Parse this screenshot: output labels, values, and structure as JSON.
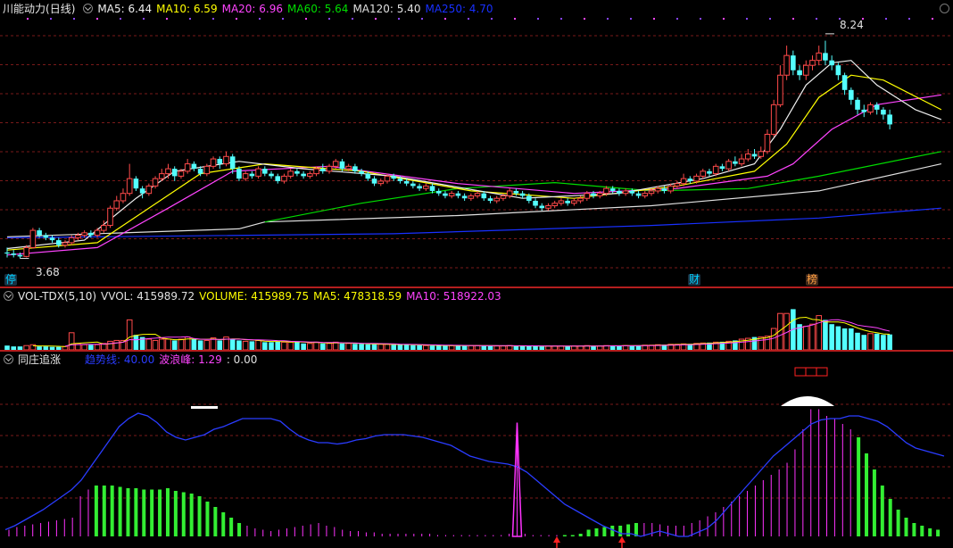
{
  "colors": {
    "up": "#ff4a4a",
    "down": "#54ffff",
    "ma5": "#f0f0f0",
    "ma10": "#ffff00",
    "ma20": "#ff44ff",
    "ma60": "#00dd00",
    "ma120": "#e0e0e0",
    "ma250": "#1830ff",
    "grid": "#7a1a1a",
    "wave": "#2a3cff",
    "green_bar": "#33ee33",
    "magenta_bar": "#ff33ff",
    "arrow": "#ff2222"
  },
  "price_panel": {
    "title": "川能动力",
    "period": "(日线)",
    "ma_legend": [
      {
        "label": "MA5: 6.44",
        "color": "#f0f0f0"
      },
      {
        "label": "MA10: 6.59",
        "color": "#ffff00"
      },
      {
        "label": "MA20: 6.96",
        "color": "#ff44ff"
      },
      {
        "label": "MA60: 5.64",
        "color": "#00dd00"
      },
      {
        "label": "MA120: 5.40",
        "color": "#e0e0e0"
      },
      {
        "label": "MA250: 4.70",
        "color": "#1830ff"
      }
    ],
    "high_label": "8.24",
    "low_label": "3.68",
    "event_tags": [
      "停",
      "财",
      "榜"
    ],
    "icon": "circle-button-icon"
  },
  "volume_panel": {
    "name": "VOL-TDX(5,10)",
    "legend": [
      {
        "label": "VVOL: 415989.72",
        "color": "#e0e0e0"
      },
      {
        "label": "VOLUME: 415989.75",
        "color": "#ffff00"
      },
      {
        "label": "MA5: 478318.59",
        "color": "#ffff00"
      },
      {
        "label": "MA10: 518922.03",
        "color": "#ff44ff"
      }
    ]
  },
  "indicator_panel": {
    "name": "同庄追涨",
    "legend": [
      {
        "label": "趋势线: 40.00",
        "color": "#2a3cff"
      },
      {
        "label": "波浪峰: 1.29",
        "color": "#ff44ff"
      },
      {
        "label": ": 0.00",
        "color": "#e0e0e0"
      }
    ]
  },
  "chart_data": {
    "type": "candlestick",
    "ylim": [
      3.4,
      8.6
    ],
    "high": 8.24,
    "low": 3.68,
    "candles": [
      [
        3.8,
        3.78,
        3.9,
        3.7
      ],
      [
        3.78,
        3.75,
        3.85,
        3.7
      ],
      [
        3.75,
        3.72,
        3.8,
        3.68
      ],
      [
        3.72,
        3.9,
        3.95,
        3.7
      ],
      [
        3.9,
        4.25,
        4.3,
        3.88
      ],
      [
        4.25,
        4.15,
        4.3,
        4.1
      ],
      [
        4.15,
        4.1,
        4.2,
        4.05
      ],
      [
        4.1,
        4.05,
        4.15,
        4.0
      ],
      [
        4.05,
        3.95,
        4.1,
        3.9
      ],
      [
        3.95,
        4.0,
        4.05,
        3.9
      ],
      [
        4.0,
        4.1,
        4.15,
        3.95
      ],
      [
        4.1,
        4.15,
        4.2,
        4.05
      ],
      [
        4.15,
        4.2,
        4.25,
        4.1
      ],
      [
        4.2,
        4.15,
        4.25,
        4.1
      ],
      [
        4.15,
        4.25,
        4.3,
        4.1
      ],
      [
        4.25,
        4.35,
        4.45,
        4.2
      ],
      [
        4.35,
        4.7,
        4.75,
        4.3
      ],
      [
        4.7,
        4.85,
        4.95,
        4.65
      ],
      [
        4.85,
        5.0,
        5.1,
        4.8
      ],
      [
        5.0,
        5.3,
        5.6,
        4.95
      ],
      [
        5.3,
        5.1,
        5.35,
        5.05
      ],
      [
        5.1,
        5.0,
        5.15,
        4.9
      ],
      [
        5.0,
        5.15,
        5.2,
        4.95
      ],
      [
        5.15,
        5.3,
        5.35,
        5.1
      ],
      [
        5.3,
        5.4,
        5.5,
        5.25
      ],
      [
        5.4,
        5.5,
        5.6,
        5.3
      ],
      [
        5.5,
        5.35,
        5.55,
        5.25
      ],
      [
        5.35,
        5.45,
        5.5,
        5.3
      ],
      [
        5.45,
        5.6,
        5.7,
        5.4
      ],
      [
        5.6,
        5.5,
        5.65,
        5.45
      ],
      [
        5.5,
        5.4,
        5.55,
        5.35
      ],
      [
        5.4,
        5.55,
        5.6,
        5.35
      ],
      [
        5.55,
        5.7,
        5.75,
        5.5
      ],
      [
        5.7,
        5.6,
        5.75,
        5.5
      ],
      [
        5.6,
        5.75,
        5.85,
        5.55
      ],
      [
        5.75,
        5.5,
        5.8,
        5.4
      ],
      [
        5.5,
        5.3,
        5.55,
        5.25
      ],
      [
        5.3,
        5.4,
        5.45,
        5.25
      ],
      [
        5.4,
        5.35,
        5.45,
        5.3
      ],
      [
        5.35,
        5.5,
        5.55,
        5.3
      ],
      [
        5.5,
        5.4,
        5.55,
        5.35
      ],
      [
        5.4,
        5.35,
        5.45,
        5.3
      ],
      [
        5.35,
        5.25,
        5.4,
        5.2
      ],
      [
        5.25,
        5.35,
        5.4,
        5.2
      ],
      [
        5.35,
        5.45,
        5.5,
        5.3
      ],
      [
        5.45,
        5.4,
        5.5,
        5.35
      ],
      [
        5.4,
        5.35,
        5.45,
        5.3
      ],
      [
        5.35,
        5.4,
        5.45,
        5.3
      ],
      [
        5.4,
        5.5,
        5.55,
        5.35
      ],
      [
        5.5,
        5.45,
        5.6,
        5.4
      ],
      [
        5.45,
        5.55,
        5.6,
        5.4
      ],
      [
        5.55,
        5.65,
        5.7,
        5.5
      ],
      [
        5.65,
        5.5,
        5.7,
        5.45
      ],
      [
        5.5,
        5.55,
        5.6,
        5.45
      ],
      [
        5.55,
        5.45,
        5.6,
        5.4
      ],
      [
        5.45,
        5.4,
        5.5,
        5.35
      ],
      [
        5.4,
        5.3,
        5.45,
        5.25
      ],
      [
        5.3,
        5.2,
        5.35,
        5.15
      ],
      [
        5.2,
        5.25,
        5.3,
        5.15
      ],
      [
        5.25,
        5.35,
        5.4,
        5.2
      ],
      [
        5.35,
        5.3,
        5.4,
        5.25
      ],
      [
        5.3,
        5.25,
        5.35,
        5.2
      ],
      [
        5.25,
        5.2,
        5.3,
        5.15
      ],
      [
        5.2,
        5.15,
        5.25,
        5.1
      ],
      [
        5.15,
        5.1,
        5.2,
        5.05
      ],
      [
        5.1,
        5.15,
        5.2,
        5.05
      ],
      [
        5.15,
        5.05,
        5.2,
        5.0
      ],
      [
        5.05,
        5.0,
        5.1,
        4.95
      ],
      [
        5.0,
        4.95,
        5.05,
        4.9
      ],
      [
        4.95,
        5.0,
        5.05,
        4.9
      ],
      [
        5.0,
        4.95,
        5.05,
        4.9
      ],
      [
        4.95,
        4.9,
        5.0,
        4.85
      ],
      [
        4.9,
        4.95,
        5.0,
        4.85
      ],
      [
        4.95,
        5.0,
        5.05,
        4.9
      ],
      [
        5.0,
        4.9,
        5.05,
        4.85
      ],
      [
        4.9,
        4.85,
        4.95,
        4.8
      ],
      [
        4.85,
        4.9,
        4.95,
        4.8
      ],
      [
        4.9,
        4.95,
        5.0,
        4.85
      ],
      [
        4.95,
        5.05,
        5.1,
        4.9
      ],
      [
        5.05,
        5.0,
        5.1,
        4.95
      ],
      [
        5.0,
        4.95,
        5.05,
        4.9
      ],
      [
        4.95,
        4.85,
        5.0,
        4.8
      ],
      [
        4.85,
        4.75,
        4.9,
        4.7
      ],
      [
        4.75,
        4.7,
        4.8,
        4.65
      ],
      [
        4.7,
        4.75,
        4.8,
        4.65
      ],
      [
        4.75,
        4.8,
        4.85,
        4.7
      ],
      [
        4.8,
        4.85,
        4.9,
        4.75
      ],
      [
        4.85,
        4.8,
        4.9,
        4.75
      ],
      [
        4.8,
        4.85,
        4.9,
        4.75
      ],
      [
        4.85,
        4.9,
        4.95,
        4.8
      ],
      [
        4.9,
        5.0,
        5.05,
        4.85
      ],
      [
        5.0,
        4.95,
        5.05,
        4.9
      ],
      [
        4.95,
        5.0,
        5.05,
        4.9
      ],
      [
        5.0,
        5.1,
        5.15,
        4.95
      ],
      [
        5.1,
        5.05,
        5.15,
        5.0
      ],
      [
        5.05,
        5.0,
        5.1,
        4.95
      ],
      [
        5.0,
        5.05,
        5.1,
        4.95
      ],
      [
        5.05,
        5.0,
        5.1,
        4.95
      ],
      [
        5.0,
        4.95,
        5.05,
        4.9
      ],
      [
        4.95,
        5.0,
        5.05,
        4.9
      ],
      [
        5.0,
        5.05,
        5.1,
        4.95
      ],
      [
        5.05,
        5.1,
        5.15,
        5.0
      ],
      [
        5.1,
        5.05,
        5.15,
        5.0
      ],
      [
        5.05,
        5.15,
        5.2,
        5.0
      ],
      [
        5.15,
        5.2,
        5.25,
        5.1
      ],
      [
        5.2,
        5.3,
        5.4,
        5.15
      ],
      [
        5.3,
        5.25,
        5.35,
        5.2
      ],
      [
        5.25,
        5.35,
        5.4,
        5.2
      ],
      [
        5.35,
        5.45,
        5.5,
        5.3
      ],
      [
        5.45,
        5.4,
        5.5,
        5.35
      ],
      [
        5.4,
        5.55,
        5.6,
        5.35
      ],
      [
        5.55,
        5.5,
        5.6,
        5.45
      ],
      [
        5.5,
        5.65,
        5.7,
        5.45
      ],
      [
        5.65,
        5.6,
        5.75,
        5.55
      ],
      [
        5.6,
        5.7,
        5.8,
        5.55
      ],
      [
        5.7,
        5.8,
        5.9,
        5.65
      ],
      [
        5.8,
        5.75,
        5.9,
        5.7
      ],
      [
        5.75,
        5.85,
        5.95,
        5.7
      ],
      [
        5.85,
        6.2,
        6.3,
        5.8
      ],
      [
        6.2,
        6.8,
        6.9,
        6.15
      ],
      [
        6.8,
        7.4,
        7.6,
        6.75
      ],
      [
        7.4,
        7.8,
        8.0,
        7.3
      ],
      [
        7.8,
        7.5,
        7.9,
        7.4
      ],
      [
        7.5,
        7.4,
        7.6,
        7.3
      ],
      [
        7.4,
        7.6,
        7.7,
        7.3
      ],
      [
        7.6,
        7.7,
        7.8,
        7.5
      ],
      [
        7.7,
        7.85,
        8.0,
        7.6
      ],
      [
        7.85,
        7.7,
        8.1,
        7.6
      ],
      [
        7.7,
        7.6,
        7.8,
        7.5
      ],
      [
        7.6,
        7.4,
        7.65,
        7.3
      ],
      [
        7.4,
        7.1,
        7.45,
        7.0
      ],
      [
        7.1,
        6.9,
        7.15,
        6.8
      ],
      [
        6.9,
        6.7,
        6.95,
        6.6
      ],
      [
        6.7,
        6.65,
        6.8,
        6.55
      ],
      [
        6.65,
        6.8,
        6.85,
        6.6
      ],
      [
        6.8,
        6.7,
        6.85,
        6.6
      ],
      [
        6.7,
        6.6,
        6.75,
        6.5
      ],
      [
        6.6,
        6.4,
        6.7,
        6.3
      ]
    ],
    "ma_lines": {
      "ma5": [
        [
          0,
          3.88
        ],
        [
          12,
          4.05
        ],
        [
          20,
          4.9
        ],
        [
          26,
          5.45
        ],
        [
          36,
          5.65
        ],
        [
          46,
          5.5
        ],
        [
          60,
          5.35
        ],
        [
          80,
          4.9
        ],
        [
          95,
          5.0
        ],
        [
          108,
          5.3
        ],
        [
          116,
          5.6
        ],
        [
          120,
          6.3
        ],
        [
          124,
          7.2
        ],
        [
          128,
          7.65
        ],
        [
          131,
          7.7
        ],
        [
          135,
          7.2
        ],
        [
          141,
          6.7
        ],
        [
          145,
          6.5
        ]
      ],
      "ma10": [
        [
          0,
          3.85
        ],
        [
          14,
          4.0
        ],
        [
          22,
          4.7
        ],
        [
          30,
          5.4
        ],
        [
          40,
          5.6
        ],
        [
          55,
          5.45
        ],
        [
          72,
          5.05
        ],
        [
          88,
          4.9
        ],
        [
          104,
          5.15
        ],
        [
          116,
          5.45
        ],
        [
          121,
          6.0
        ],
        [
          126,
          6.95
        ],
        [
          131,
          7.4
        ],
        [
          136,
          7.3
        ],
        [
          145,
          6.7
        ]
      ],
      "ma20": [
        [
          0,
          3.75
        ],
        [
          14,
          3.9
        ],
        [
          25,
          4.7
        ],
        [
          35,
          5.45
        ],
        [
          50,
          5.55
        ],
        [
          70,
          5.2
        ],
        [
          88,
          5.0
        ],
        [
          104,
          5.1
        ],
        [
          118,
          5.35
        ],
        [
          122,
          5.6
        ],
        [
          128,
          6.3
        ],
        [
          135,
          6.8
        ],
        [
          145,
          7.0
        ]
      ],
      "ma60": [
        [
          40,
          4.42
        ],
        [
          55,
          4.8
        ],
        [
          70,
          5.1
        ],
        [
          85,
          5.22
        ],
        [
          100,
          5.05
        ],
        [
          115,
          5.1
        ],
        [
          126,
          5.35
        ],
        [
          145,
          5.85
        ]
      ],
      "ma120": [
        [
          0,
          4.12
        ],
        [
          36,
          4.28
        ],
        [
          40,
          4.42
        ],
        [
          70,
          4.55
        ],
        [
          100,
          4.75
        ],
        [
          126,
          5.05
        ],
        [
          145,
          5.6
        ]
      ],
      "ma250": [
        [
          0,
          4.1
        ],
        [
          60,
          4.18
        ],
        [
          100,
          4.35
        ],
        [
          126,
          4.5
        ],
        [
          145,
          4.7
        ]
      ]
    },
    "volumes": [
      0.1,
      0.08,
      0.08,
      0.1,
      0.12,
      0.08,
      0.08,
      0.07,
      0.07,
      0.08,
      0.4,
      0.15,
      0.12,
      0.12,
      0.12,
      0.15,
      0.2,
      0.22,
      0.22,
      0.7,
      0.35,
      0.3,
      0.25,
      0.22,
      0.25,
      0.25,
      0.22,
      0.25,
      0.3,
      0.25,
      0.22,
      0.22,
      0.28,
      0.22,
      0.3,
      0.25,
      0.22,
      0.2,
      0.2,
      0.22,
      0.18,
      0.18,
      0.2,
      0.18,
      0.18,
      0.2,
      0.15,
      0.15,
      0.18,
      0.15,
      0.15,
      0.18,
      0.15,
      0.15,
      0.14,
      0.14,
      0.13,
      0.13,
      0.13,
      0.13,
      0.12,
      0.12,
      0.12,
      0.11,
      0.11,
      0.1,
      0.1,
      0.1,
      0.1,
      0.1,
      0.1,
      0.1,
      0.1,
      0.1,
      0.1,
      0.09,
      0.09,
      0.09,
      0.1,
      0.09,
      0.09,
      0.09,
      0.09,
      0.08,
      0.09,
      0.09,
      0.09,
      0.09,
      0.09,
      0.09,
      0.1,
      0.09,
      0.09,
      0.1,
      0.1,
      0.1,
      0.1,
      0.1,
      0.1,
      0.11,
      0.11,
      0.12,
      0.12,
      0.13,
      0.13,
      0.14,
      0.14,
      0.15,
      0.16,
      0.17,
      0.18,
      0.19,
      0.2,
      0.22,
      0.25,
      0.27,
      0.3,
      0.3,
      0.32,
      0.5,
      0.85,
      0.85,
      0.95,
      0.6,
      0.55,
      0.6,
      0.8,
      0.7,
      0.6,
      0.55,
      0.5,
      0.5,
      0.4,
      0.35,
      0.38,
      0.38,
      0.35,
      0.36,
      0.35
    ],
    "trend_line": [
      0.05,
      0.08,
      0.12,
      0.16,
      0.2,
      0.25,
      0.3,
      0.35,
      0.42,
      0.52,
      0.62,
      0.72,
      0.82,
      0.88,
      0.92,
      0.9,
      0.85,
      0.78,
      0.74,
      0.72,
      0.74,
      0.76,
      0.8,
      0.82,
      0.85,
      0.88,
      0.88,
      0.88,
      0.88,
      0.86,
      0.8,
      0.75,
      0.72,
      0.7,
      0.7,
      0.69,
      0.7,
      0.72,
      0.73,
      0.75,
      0.76,
      0.76,
      0.76,
      0.75,
      0.74,
      0.72,
      0.7,
      0.68,
      0.64,
      0.6,
      0.58,
      0.56,
      0.55,
      0.54,
      0.52,
      0.48,
      0.42,
      0.36,
      0.3,
      0.24,
      0.2,
      0.16,
      0.12,
      0.08,
      0.05,
      0.02,
      0.02,
      0.0,
      0.02,
      0.04,
      0.02,
      0.0,
      0.0,
      0.03,
      0.06,
      0.12,
      0.2,
      0.28,
      0.36,
      0.44,
      0.52,
      0.6,
      0.66,
      0.72,
      0.78,
      0.84,
      0.87,
      0.88,
      0.88,
      0.9,
      0.9,
      0.88,
      0.86,
      0.82,
      0.76,
      0.7,
      0.66,
      0.64,
      0.62,
      0.6
    ],
    "wave_bars": [
      0.05,
      0.07,
      0.08,
      0.09,
      0.1,
      0.11,
      0.12,
      0.13,
      0.14,
      0.3,
      0.35,
      0.38,
      0.38,
      0.38,
      0.37,
      0.36,
      0.36,
      0.35,
      0.35,
      0.35,
      0.36,
      0.34,
      0.33,
      0.32,
      0.3,
      0.26,
      0.22,
      0.18,
      0.14,
      0.1,
      0.08,
      0.06,
      0.05,
      0.04,
      0.05,
      0.06,
      0.07,
      0.08,
      0.09,
      0.1,
      0.08,
      0.07,
      0.05,
      0.04,
      0.04,
      0.03,
      0.03,
      0.02,
      0.02,
      0.02,
      0.02,
      0.02,
      0.02,
      0.02,
      0.01,
      0.01,
      0.01,
      0.01,
      0.01,
      0.01,
      0.01,
      0.01,
      0.01,
      0.02,
      0.85,
      0.02,
      0.01,
      0.01,
      0.01,
      0.01,
      0.01,
      0.01,
      0.02,
      0.05,
      0.06,
      0.07,
      0.08,
      0.08,
      0.09,
      0.1,
      0.1,
      0.1,
      0.09,
      0.08,
      0.08,
      0.08,
      0.1,
      0.12,
      0.15,
      0.18,
      0.22,
      0.26,
      0.3,
      0.34,
      0.38,
      0.42,
      0.46,
      0.5,
      0.55,
      0.65,
      0.8,
      0.95,
      0.95,
      0.9,
      0.88,
      0.84,
      0.8,
      0.74,
      0.62,
      0.5,
      0.38,
      0.28,
      0.2,
      0.14,
      0.1,
      0.08,
      0.06,
      0.05
    ],
    "wave_colors": "mmmmmmmmmmmgggggggggggggggggggmmmmmmmmmmmmmmmmmmmmmmmmmmmmmmmmmmmmmmmmggggggggggmmmmmmmmmmmmmmmmmmmmmmmmmmmggggggggggggggg"
  }
}
